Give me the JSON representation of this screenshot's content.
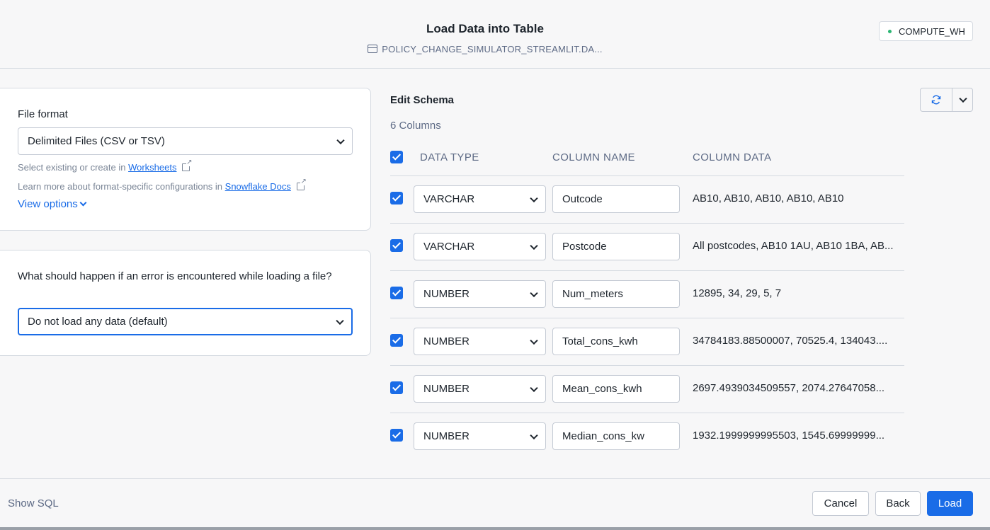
{
  "header": {
    "title": "Load Data into Table",
    "subtitle": "POLICY_CHANGE_SIMULATOR_STREAMLIT.DA...",
    "warehouse": "COMPUTE_WH"
  },
  "file_format": {
    "label": "File format",
    "value": "Delimited Files (CSV or TSV)",
    "hint1_prefix": "Select existing or create in ",
    "hint1_link": "Worksheets",
    "hint2_prefix": "Learn more about format-specific configurations in ",
    "hint2_link": "Snowflake Docs",
    "view_options": "View options"
  },
  "error_handling": {
    "question": "What should happen if an error is encountered while loading a file?",
    "value": "Do not load any data (default)"
  },
  "schema": {
    "title": "Edit Schema",
    "count": "6 Columns",
    "headers": {
      "type": "DATA TYPE",
      "name": "COLUMN NAME",
      "data": "COLUMN DATA"
    },
    "rows": [
      {
        "type": "VARCHAR",
        "name": "Outcode",
        "data": "AB10, AB10, AB10, AB10, AB10"
      },
      {
        "type": "VARCHAR",
        "name": "Postcode",
        "data": "All postcodes, AB10 1AU, AB10 1BA, AB..."
      },
      {
        "type": "NUMBER",
        "name": "Num_meters",
        "data": "12895, 34, 29, 5, 7"
      },
      {
        "type": "NUMBER",
        "name": "Total_cons_kwh",
        "data": "34784183.88500007, 70525.4, 134043...."
      },
      {
        "type": "NUMBER",
        "name": "Mean_cons_kwh",
        "data": "2697.4939034509557, 2074.27647058..."
      },
      {
        "type": "NUMBER",
        "name": "Median_cons_kw",
        "data": "1932.1999999995503, 1545.69999999..."
      }
    ]
  },
  "footer": {
    "show_sql": "Show SQL",
    "cancel": "Cancel",
    "back": "Back",
    "load": "Load"
  }
}
